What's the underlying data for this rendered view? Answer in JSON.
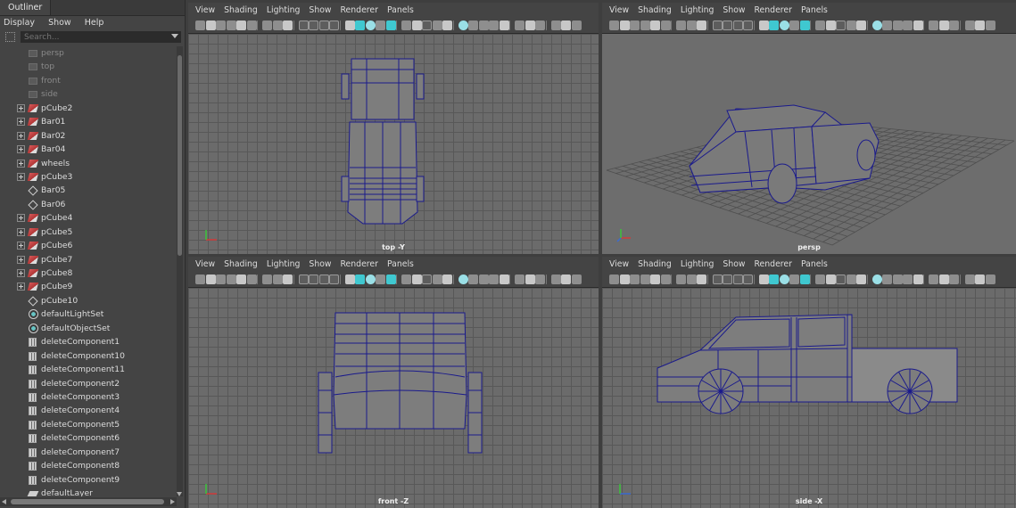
{
  "outliner": {
    "tab_label": "Outliner",
    "menu": [
      "Display",
      "Show",
      "Help"
    ],
    "search_placeholder": "Search...",
    "items": [
      {
        "label": "persp",
        "icon": "camera-icon",
        "expand": false,
        "dim": true
      },
      {
        "label": "top",
        "icon": "camera-icon",
        "expand": false,
        "dim": true
      },
      {
        "label": "front",
        "icon": "camera-icon",
        "expand": false,
        "dim": true
      },
      {
        "label": "side",
        "icon": "camera-icon",
        "expand": false,
        "dim": true
      },
      {
        "label": "pCube2",
        "icon": "mesh-icon",
        "expand": true,
        "dim": false
      },
      {
        "label": "Bar01",
        "icon": "mesh-icon",
        "expand": true,
        "dim": false
      },
      {
        "label": "Bar02",
        "icon": "mesh-icon",
        "expand": true,
        "dim": false
      },
      {
        "label": "Bar04",
        "icon": "mesh-icon",
        "expand": true,
        "dim": false
      },
      {
        "label": "wheels",
        "icon": "mesh-icon",
        "expand": true,
        "dim": false
      },
      {
        "label": "pCube3",
        "icon": "mesh-icon",
        "expand": true,
        "dim": false
      },
      {
        "label": "Bar05",
        "icon": "group-icon",
        "expand": false,
        "dim": false
      },
      {
        "label": "Bar06",
        "icon": "group-icon",
        "expand": false,
        "dim": false
      },
      {
        "label": "pCube4",
        "icon": "mesh-icon",
        "expand": true,
        "dim": false
      },
      {
        "label": "pCube5",
        "icon": "mesh-icon",
        "expand": true,
        "dim": false
      },
      {
        "label": "pCube6",
        "icon": "mesh-icon",
        "expand": true,
        "dim": false
      },
      {
        "label": "pCube7",
        "icon": "mesh-icon",
        "expand": true,
        "dim": false
      },
      {
        "label": "pCube8",
        "icon": "mesh-icon",
        "expand": true,
        "dim": false
      },
      {
        "label": "pCube9",
        "icon": "mesh-icon",
        "expand": true,
        "dim": false
      },
      {
        "label": "pCube10",
        "icon": "group-icon",
        "expand": false,
        "dim": false
      },
      {
        "label": "defaultLightSet",
        "icon": "set-icon",
        "expand": false,
        "dim": false
      },
      {
        "label": "defaultObjectSet",
        "icon": "set-icon",
        "expand": false,
        "dim": false
      },
      {
        "label": "deleteComponent1",
        "icon": "node-icon",
        "expand": false,
        "dim": false
      },
      {
        "label": "deleteComponent10",
        "icon": "node-icon",
        "expand": false,
        "dim": false
      },
      {
        "label": "deleteComponent11",
        "icon": "node-icon",
        "expand": false,
        "dim": false
      },
      {
        "label": "deleteComponent2",
        "icon": "node-icon",
        "expand": false,
        "dim": false
      },
      {
        "label": "deleteComponent3",
        "icon": "node-icon",
        "expand": false,
        "dim": false
      },
      {
        "label": "deleteComponent4",
        "icon": "node-icon",
        "expand": false,
        "dim": false
      },
      {
        "label": "deleteComponent5",
        "icon": "node-icon",
        "expand": false,
        "dim": false
      },
      {
        "label": "deleteComponent6",
        "icon": "node-icon",
        "expand": false,
        "dim": false
      },
      {
        "label": "deleteComponent7",
        "icon": "node-icon",
        "expand": false,
        "dim": false
      },
      {
        "label": "deleteComponent8",
        "icon": "node-icon",
        "expand": false,
        "dim": false
      },
      {
        "label": "deleteComponent9",
        "icon": "node-icon",
        "expand": false,
        "dim": false
      },
      {
        "label": "defaultLayer",
        "icon": "layer-icon",
        "expand": false,
        "dim": false
      }
    ]
  },
  "viewport_menu": [
    "View",
    "Shading",
    "Lighting",
    "Show",
    "Renderer",
    "Panels"
  ],
  "viewports": {
    "top": {
      "label": "top -Y"
    },
    "persp": {
      "label": "persp"
    },
    "front": {
      "label": "front -Z"
    },
    "side": {
      "label": "side -X"
    }
  },
  "colors": {
    "wireframe": "#1a1a8c",
    "accent": "#3fc8d0",
    "grid_bg": "#6b6b6b",
    "axis_x": "#d23b3b",
    "axis_y": "#3bc43b",
    "axis_z": "#3b6bd2"
  }
}
